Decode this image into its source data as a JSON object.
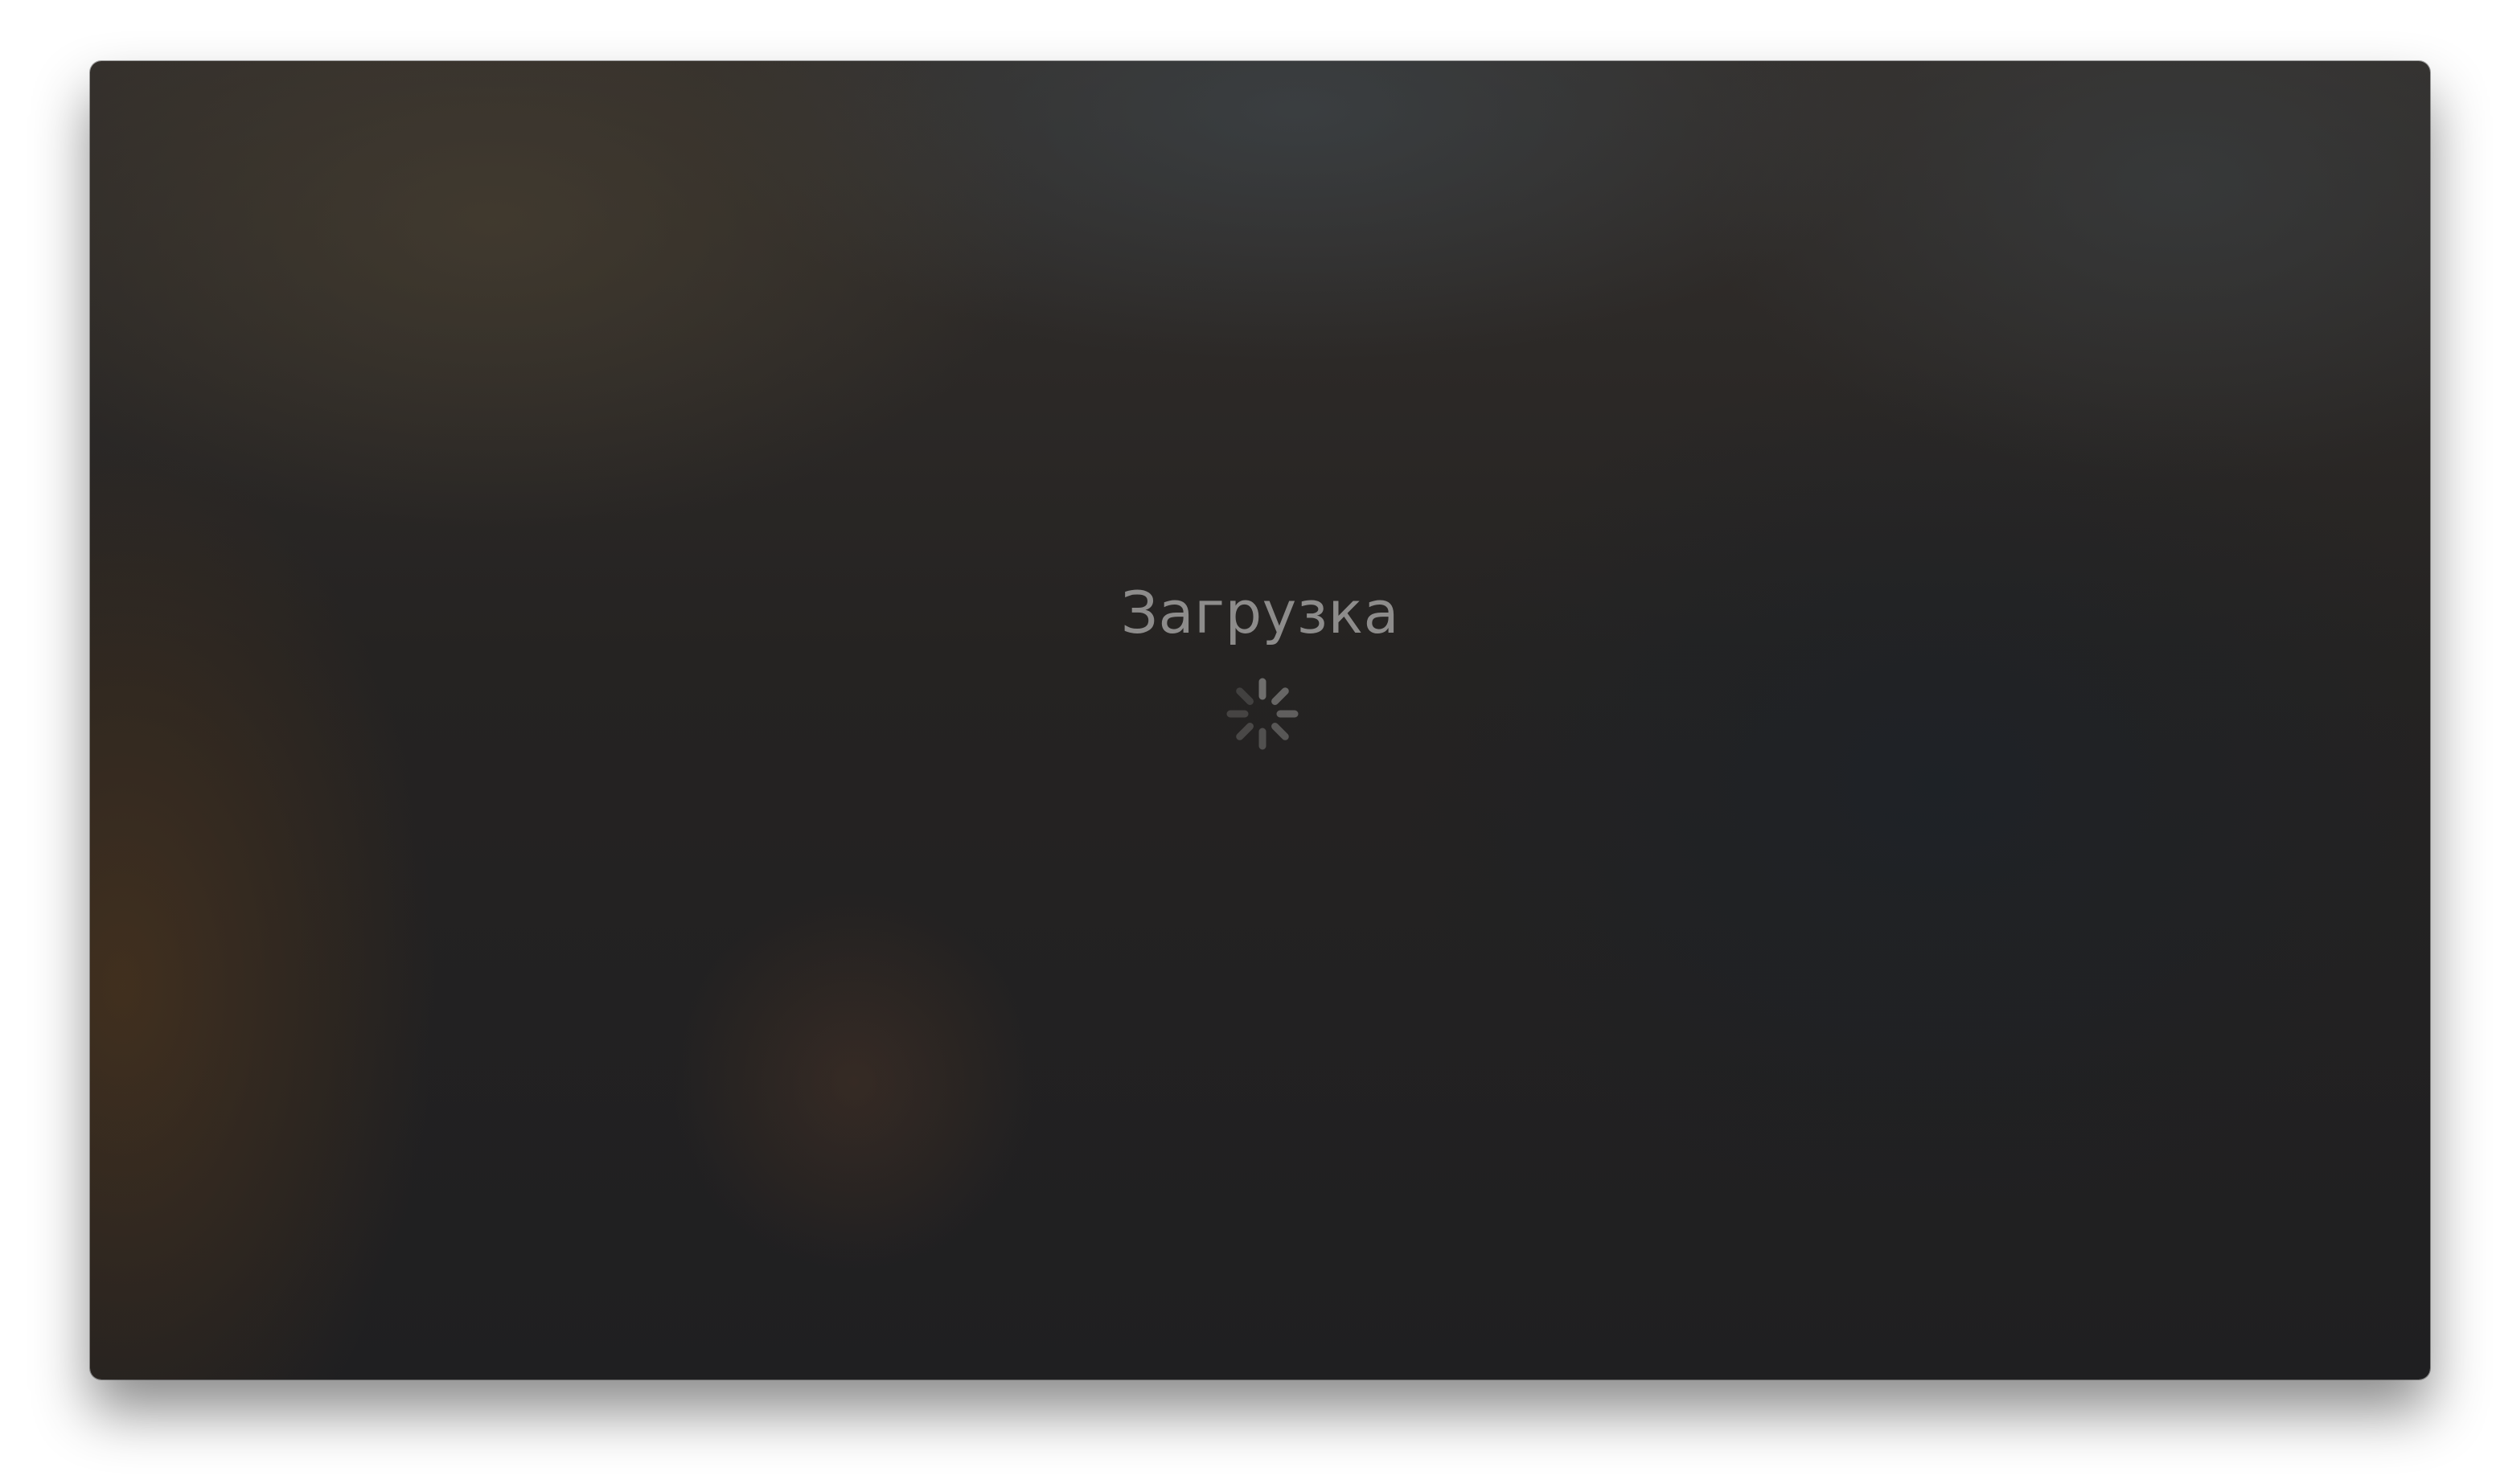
{
  "loading": {
    "label": "Загрузка",
    "spinner_icon": "activity-spinner-icon"
  },
  "colors": {
    "label": "#8d8c8b",
    "spinner": "#6f6e6d"
  }
}
